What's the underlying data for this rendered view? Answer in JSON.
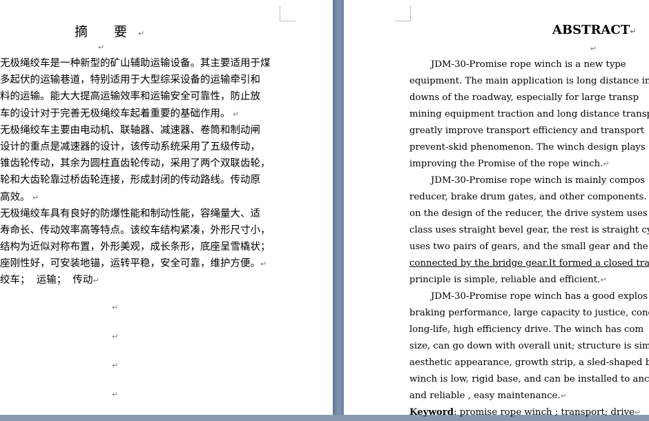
{
  "chinese_page": {
    "title": "摘 要",
    "lines": [
      "无极绳绞车是一种新型的矿山辅助运输设备。其主要适用于煤",
      "多起伏的运输巷道，特别适用于大型综采设备的运输牵引和",
      "料的运输。能大大提高运输效率和运输安全可靠性，防止放",
      "车的设计对于完善无极绳绞车起着重要的基础作用。",
      "无极绳绞车主要由电动机、联轴器、减速器、卷筒和制动闸",
      "设计的重点是减速器的设计，该传动系统采用了五级传动，",
      "锥齿轮传动，其余为圆柱直齿轮传动，采用了两个双联齿轮，",
      "轮和大齿轮靠过桥齿轮连接，形成封闭的传动路线。传动原",
      "高效。",
      "无极绳绞车具有良好的防爆性能和制动性能，容绳量大、适",
      "寿命长、传动效率高等特点。该绞车结构紧凑，外形尺寸小，",
      "结构为近似对称布置，外形美观，成长条形，底座呈雪橇状；",
      "座刚性好，可安装地锚，运转平稳，安全可靠，维护方便。",
      "绞车；  运输；  传动"
    ]
  },
  "english_page": {
    "title": "ABSTRACT",
    "lines": [
      "JDM-30-Promise rope winch is a new type",
      "equipment. The main application is long distance in t",
      "downs of the roadway, especially for large transp",
      "mining equipment traction and long distance transpo",
      "greatly improve transport efficiency and transport",
      "prevent-skid phenomenon. The winch design plays",
      "improving the Promise of the rope winch.",
      "JDM-30-Promise rope winch is mainly compos",
      "reducer, brake drum gates, and other components. The",
      "on the design of the reducer, the drive system uses",
      "class uses straight bevel gear, the rest is straight cyli",
      "uses two pairs of gears, and the small gear and the b",
      "connected by the bridge gear.It formed a closed trans",
      "principle is simple, reliable and efficient.",
      "JDM-30-Promise rope winch has a good explos",
      "braking performance, large capacity to justice, condi",
      "long-life, high efficiency drive. The winch has com",
      "size, can go down with overall unit; structure is sim",
      "aesthetic appearance, growth strip, a sled-shaped bas",
      "winch is low, rigid base, and can be installed to anch",
      "and reliable , easy maintenance."
    ],
    "keyword_label": "Keyword",
    "keyword_text": ": promise rope winch ; transport; drive"
  },
  "colors": {
    "background": "#8a9bb0",
    "gutter": "#6d83a2",
    "paper": "#ffffff",
    "text": "#000000",
    "para_mark": "#7b7b7b"
  }
}
